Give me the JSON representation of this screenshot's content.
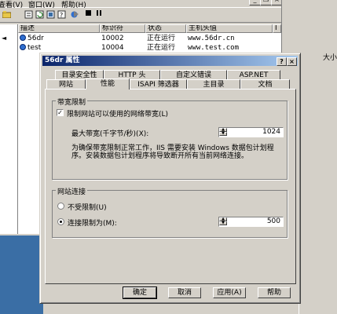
{
  "menu": {
    "items": [
      "查看(V)",
      "窗口(W)",
      "帮助(H)"
    ]
  },
  "window_controls": {
    "minimize": "_",
    "restore": "❐",
    "close": "×"
  },
  "toolbar": {
    "icons": [
      "folder-icon",
      "properties-icon",
      "refresh-icon",
      "export-icon",
      "help-icon",
      "web-icon",
      "play-icon",
      "stop-icon",
      "pause-icon"
    ]
  },
  "list": {
    "headers": [
      "描述",
      "标识符",
      "状态",
      "主机头值",
      "I"
    ],
    "rows": [
      {
        "name": "56dr",
        "id": "10002",
        "status": "正在运行",
        "host": "www.56dr.cn",
        "extra": ""
      },
      {
        "name": "test",
        "id": "10004",
        "status": "正在运行",
        "host": "www.test.com",
        "extra": ""
      }
    ]
  },
  "right_pane": {
    "size_header": "大小"
  },
  "dialog": {
    "title": "56dr 属性",
    "help_button": "?",
    "close_button": "×",
    "tabs_row1": [
      "目录安全性",
      "HTTP 头",
      "自定义错误",
      "ASP.NET"
    ],
    "tabs_row2": [
      "网站",
      "性能",
      "ISAPI 筛选器",
      "主目录",
      "文档"
    ],
    "active_tab": "性能",
    "bandwidth": {
      "group_title": "带宽限制",
      "limit_checkbox_label": "限制网站可以使用的网络带宽(L)",
      "limit_checked": true,
      "max_label": "最大带宽(千字节/秒)(X):",
      "max_value": "1024",
      "info_text_line1": "为确保带宽限制正常工作，IIS 需要安装 Windows 数据包计划程",
      "info_text_line2": "序。安装数据包计划程序将导致断开所有当前网络连接。"
    },
    "connections": {
      "group_title": "网站连接",
      "unlimited_label": "不受限制(U)",
      "limited_label": "连接限制为(M):",
      "selected": "limited",
      "limit_value": "500"
    },
    "buttons": {
      "ok": "确定",
      "cancel": "取消",
      "apply": "应用(A)",
      "help": "帮助"
    }
  }
}
